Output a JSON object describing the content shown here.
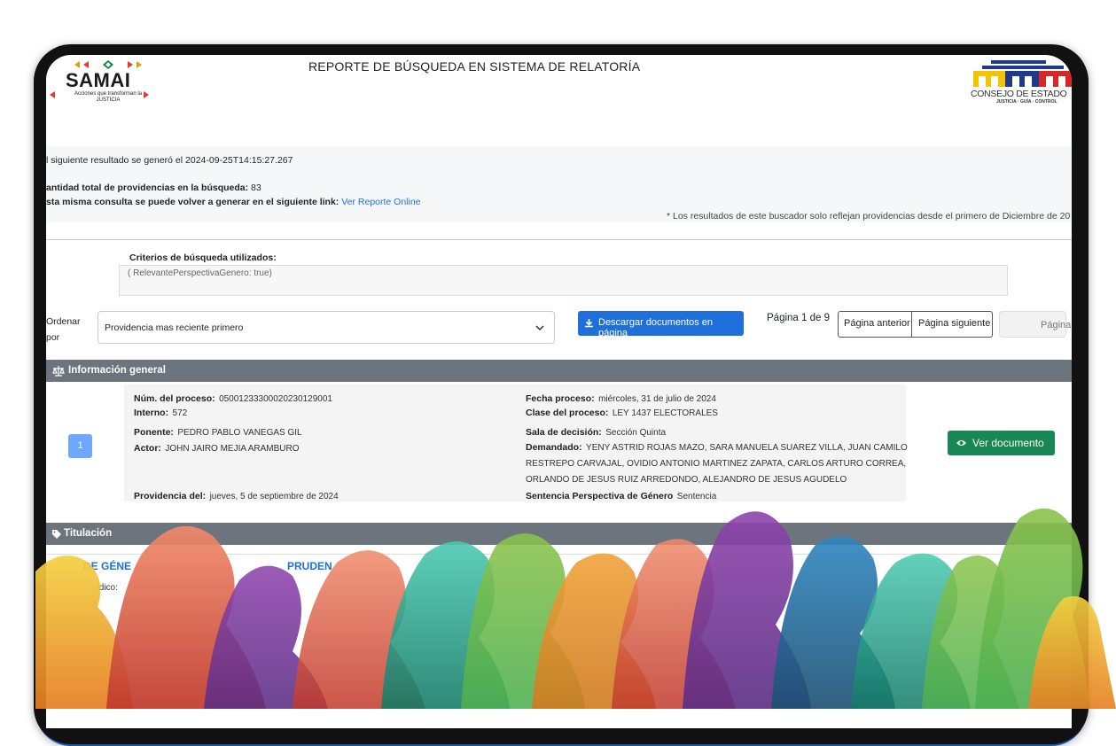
{
  "header": {
    "brand": "SAMAI",
    "brand_tagline": "Acciones que transforman la",
    "brand_tagline2": "JUSTICIA",
    "report_title": "REPORTE DE BÚSQUEDA EN SISTEMA DE RELATORÍA",
    "institution": "CONSEJO DE ESTADO",
    "institution_tagline": "JUSTICIA · GUÍA · CONTROL"
  },
  "info": {
    "generated_line": "l siguiente resultado se generó el 2024-09-25T14:15:27.267",
    "total_label": "antidad total de providencias en la búsqueda:",
    "total_value": "83",
    "link_label": "sta misma consulta se puede volver a generar en el siguiente link:",
    "link_text": "Ver Reporte Online",
    "note": "* Los resultados de este buscador solo reflejan providencias desde el primero de Diciembre de 20"
  },
  "criteria": {
    "label": "Criterios de búsqueda utilizados:",
    "value": "( RelevantePerspectivaGenero: true)"
  },
  "controls": {
    "sort_label_1": "Ordenar",
    "sort_label_2": "por",
    "sort_value": "Providencia mas reciente primero",
    "download_label": "Descargar documentos en página",
    "page_info": "Página 1 de 9",
    "prev_label": "Página anterior",
    "next_label": "Página siguiente",
    "page_placeholder": "Página"
  },
  "sections": {
    "general": "Información general",
    "titulacion": "Titulación"
  },
  "result": {
    "index": "1",
    "proceso_label": "Núm. del proceso:",
    "proceso_value": "05001233300020230129001",
    "interno_label": "Interno:",
    "interno_value": "572",
    "ponente_label": "Ponente:",
    "ponente_value": "PEDRO PABLO VANEGAS GIL",
    "actor_label": "Actor:",
    "actor_value": "JOHN JAIRO MEJIA ARAMBURO",
    "providencia_label": "Providencia del:",
    "providencia_value": "jueves, 5 de septiembre de 2024",
    "fecha_label": "Fecha proceso:",
    "fecha_value": "miércoles, 31 de julio de 2024",
    "clase_label": "Clase del proceso:",
    "clase_value": "LEY 1437 ELECTORALES",
    "sala_label": "Sala de decisión:",
    "sala_value": "Sección Quinta",
    "demandado_label": "Demandado:",
    "demandado_line1": "YENY ASTRID ROJAS MAZO, SARA MANUELA SUAREZ VILLA, JUAN CAMILO",
    "demandado_line2": "RESTREPO CARVAJAL, OVIDIO ANTONIO MARTINEZ ZAPATA, CARLOS ARTURO CORREA,",
    "demandado_line3": "ORLANDO DE JESUS RUIZ ARREDONDO, ALEJANDRO DE JESUS AGUDELO",
    "perspectiva_label": "Sentencia Perspectiva de Género",
    "perspectiva_value": "Sentencia",
    "view_label": "Ver documento"
  },
  "titulacion_tabs": {
    "tab1": "DE GÉNE",
    "tab2": "PRUDEN",
    "field": "ídico:"
  },
  "colors": {
    "primary": "#1e6fd9",
    "success": "#198754",
    "section_bar": "#6c757d",
    "badge": "#6ea8fe"
  }
}
